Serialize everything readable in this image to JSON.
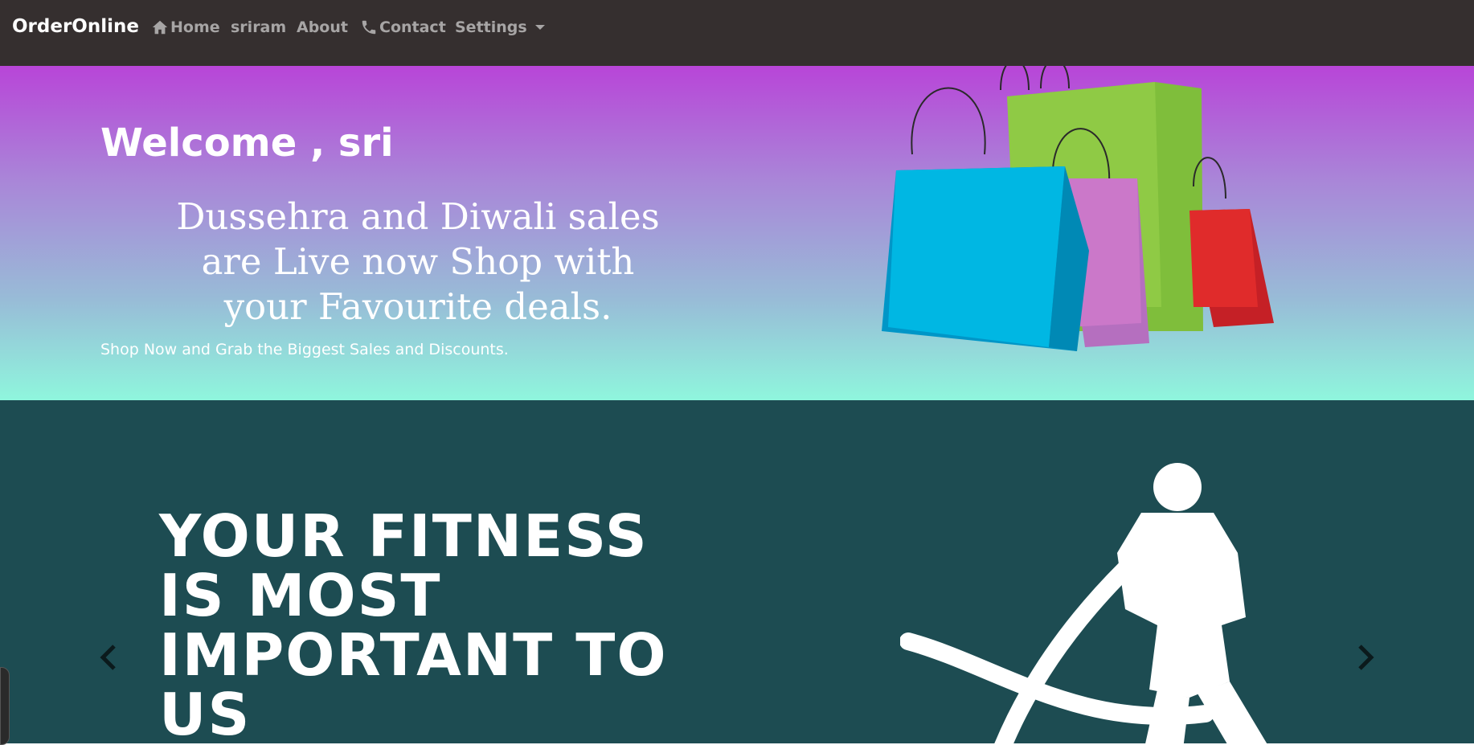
{
  "navbar": {
    "brand": "OrderOnline",
    "items": [
      {
        "label": "Home",
        "icon": "home-icon"
      },
      {
        "label": "sriram"
      },
      {
        "label": "About"
      },
      {
        "label": "Contact",
        "icon": "phone-icon"
      },
      {
        "label": "Settings",
        "icon": "caret-down-icon"
      }
    ]
  },
  "hero": {
    "welcome": "Welcome , sri",
    "promo": "Dussehra and Diwali sales are Live now Shop with your Favourite deals.",
    "subtext": "Shop Now and Grab the Biggest Sales and Discounts.",
    "image_icon": "shopping-bags-image"
  },
  "carousel": {
    "headline_lines": [
      "YOUR FITNESS",
      "IS MOST",
      "IMPORTANT TO",
      "US"
    ],
    "image_icon": "athlete-battle-ropes-image",
    "prev_icon": "chevron-left-icon",
    "next_icon": "chevron-right-icon"
  },
  "colors": {
    "navbar_bg": "#352f2f",
    "nav_text": "#a7a5a5",
    "hero_top": "#b845d8",
    "hero_bottom": "#8ff6dd",
    "carousel_bg": "#1d4c52"
  }
}
